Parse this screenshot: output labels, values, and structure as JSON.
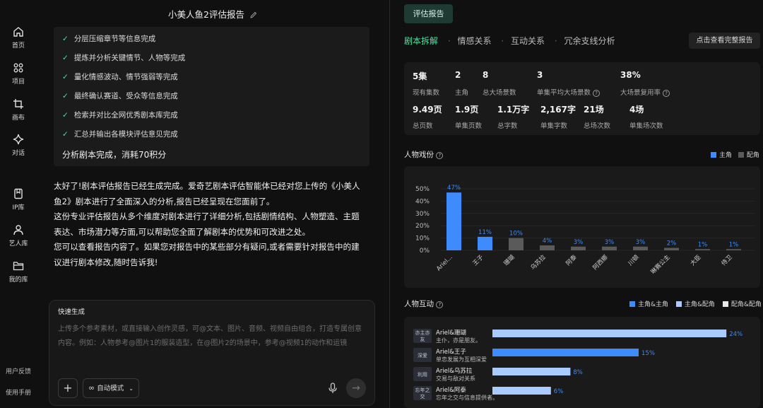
{
  "sidebar": {
    "items": [
      {
        "label": "首页",
        "icon": "home-icon"
      },
      {
        "label": "项目",
        "icon": "grid-icon"
      },
      {
        "label": "画布",
        "icon": "crop-icon"
      },
      {
        "label": "对话",
        "icon": "sparkle-icon"
      },
      {
        "label": "IP库",
        "icon": "book-icon"
      },
      {
        "label": "艺人库",
        "icon": "user-icon"
      },
      {
        "label": "我的库",
        "icon": "folder-icon"
      }
    ],
    "bottom": [
      "用户反馈",
      "使用手册"
    ]
  },
  "chat": {
    "title": "小美人鱼2评估报告",
    "steps": [
      "分层压缩章节等信息完成",
      "提炼并分析关键情节、人物等完成",
      "量化情感波动、情节强弱等完成",
      "最终确认赛道、受众等信息完成",
      "检索并对比全网优秀剧本库完成",
      "汇总并输出各模块评估意见完成"
    ],
    "summary": "分析剧本完成，消耗70积分",
    "message": [
      "太好了!剧本评估报告已经生成完成。爱奇艺剧本评估智能体已经对您上传的《小美人鱼2》剧本进行了全面深入的分析,报告已经呈现在您面前了。",
      "这份专业评估报告从多个维度对剧本进行了详细分析,包括剧情结构、人物塑造、主题表达、市场潜力等方面,可以帮助您全面了解剧本的优势和可改进之处。",
      "您可以查看报告内容了。如果您对报告中的某些部分有疑问,或者需要针对报告中的建议进行剧本修改,随时告诉我!"
    ],
    "composer": {
      "label": "快速生成",
      "placeholder": "上传多个参考素材，或直接输入创作灵感，可@文本、图片、音频、视频自由组合，打造专属创意内容。例如：人物参考@图片1的服装造型，在@图片2的场景中，参考@视频1的动作和运镜",
      "mode": "自动模式"
    }
  },
  "report": {
    "tab_label": "评估报告",
    "subtabs": [
      "剧本拆解",
      "情感关系",
      "互动关系",
      "冗余支线分析"
    ],
    "full_report_label": "点击查看完整报告",
    "stats_row1": [
      {
        "value": "5集",
        "label": "现有集数"
      },
      {
        "value": "2",
        "label": "主角"
      },
      {
        "value": "8",
        "label": "总大场景数"
      },
      {
        "value": "3",
        "label": "单集平均大场景数"
      },
      {
        "value": "38%",
        "label": "大场景复用率"
      }
    ],
    "stats_row2": [
      {
        "value": "9.49页",
        "label": "总页数"
      },
      {
        "value": "1.9页",
        "label": "单集页数"
      },
      {
        "value": "1.1万字",
        "label": "总字数"
      },
      {
        "value": "2,167字",
        "label": "单集字数"
      },
      {
        "value": "21场",
        "label": "总场次数"
      },
      {
        "value": "4场",
        "label": "单集场次数"
      }
    ],
    "role_section_title": "人物戏份",
    "interaction_section_title": "人物互动",
    "colors": {
      "main": "#3d8bfd",
      "support": "#5a5a5a",
      "light": "#a9cbff",
      "white": "#e8e8e8",
      "accent": "#4ee0a5"
    }
  },
  "chart_data": [
    {
      "type": "bar",
      "title": "人物戏份",
      "categories": [
        "Ariel...",
        "王子",
        "珊瑚",
        "乌苏拉",
        "阿泰",
        "阿西娜",
        "川顿",
        "琳赛公主",
        "大臣",
        "侍卫"
      ],
      "values": [
        47,
        11,
        10,
        4,
        3,
        3,
        3,
        2,
        1,
        1
      ],
      "roles": [
        "主角",
        "主角",
        "配角",
        "配角",
        "配角",
        "配角",
        "配角",
        "配角",
        "配角",
        "配角"
      ],
      "ylabel": "",
      "ylim": [
        0,
        50
      ],
      "yticks": [
        "50%",
        "40%",
        "30%",
        "20%",
        "10%",
        "0%"
      ],
      "series": [
        {
          "name": "主角"
        },
        {
          "name": "配角"
        }
      ],
      "legend": "top-right"
    },
    {
      "type": "bar",
      "title": "人物互动",
      "orientation": "horizontal",
      "series": [
        {
          "name": "主角&主角"
        },
        {
          "name": "主角&配角"
        },
        {
          "name": "配角&配角"
        }
      ],
      "rows": [
        {
          "tag": "亦主亦友",
          "pair": "Ariel&珊瑚",
          "desc": "主仆，亦是朋友。",
          "value": 24
        },
        {
          "tag": "深爱",
          "pair": "Ariel&王子",
          "desc": "单恋发展为互相深爱",
          "value": 15
        },
        {
          "tag": "利用",
          "pair": "Ariel&乌苏拉",
          "desc": "交易与敌对关系",
          "value": 8
        },
        {
          "tag": "忘年之交",
          "pair": "Ariel&阿泰",
          "desc": "忘年之交与信息提供者。",
          "value": 6
        }
      ],
      "legend": "top-right"
    }
  ]
}
